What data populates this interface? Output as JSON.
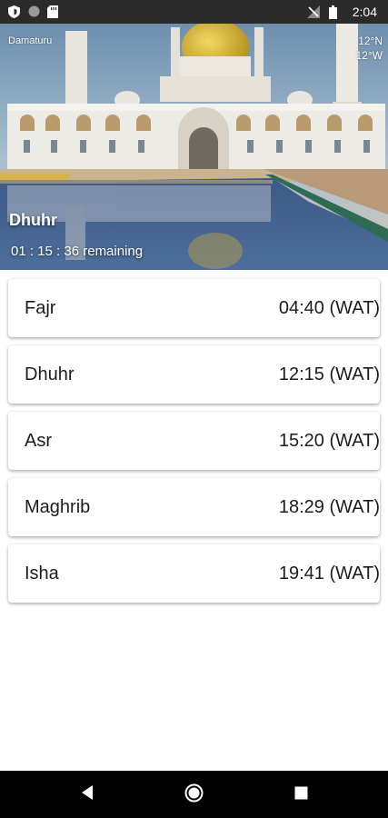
{
  "status_bar": {
    "time": "2:04",
    "icons": [
      "shield-icon",
      "circle-icon",
      "sd-card-icon",
      "no-signal-icon",
      "battery-icon"
    ]
  },
  "header": {
    "city": "Damaturu",
    "latitude": "12°N",
    "longitude": "12°W",
    "current_prayer": "Dhuhr",
    "remaining": "01 : 15 : 36 remaining"
  },
  "prayers": [
    {
      "name": "Fajr",
      "time": "04:40 (WAT)"
    },
    {
      "name": "Dhuhr",
      "time": "12:15 (WAT)"
    },
    {
      "name": "Asr",
      "time": "15:20 (WAT)"
    },
    {
      "name": "Maghrib",
      "time": "18:29 (WAT)"
    },
    {
      "name": "Isha",
      "time": "19:41 (WAT)"
    }
  ],
  "nav": {
    "icons": [
      "back-icon",
      "home-icon",
      "recents-icon"
    ]
  },
  "colors": {
    "status_bar": "#2b2b2b",
    "nav_bar": "#000000",
    "card_bg": "#ffffff",
    "dome_gold": "#d4b22a"
  }
}
